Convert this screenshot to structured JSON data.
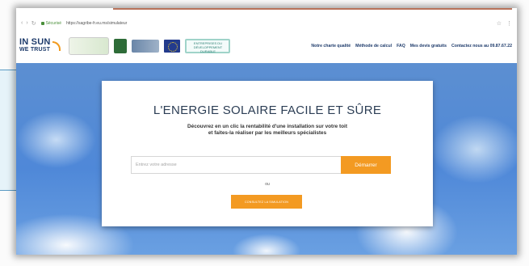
{
  "browser": {
    "secure_label": "Sécurisé",
    "url": "https://sagribe-fr.eu.ms/simulateur",
    "right_icons": [
      "star-icon",
      "menu-icon"
    ]
  },
  "logo": {
    "line1": "IN SUN",
    "line2": "WE TRUST"
  },
  "partners": {
    "p5_text": "ENTREPRISES DU DÉVELOPPEMENT DURABLE"
  },
  "topnav": [
    "Notre charte qualité",
    "Méthode de calcul",
    "FAQ",
    "Mes devis gratuits",
    "Contactez nous au 09.87.67.22"
  ],
  "hero": {
    "title": "L'ENERGIE SOLAIRE FACILE ET SÛRE",
    "lead_line1": "Découvrez en un clic la rentabilité d'une installation sur votre toit",
    "lead_line2": "et faites-la réaliser par les meilleurs spécialistes",
    "address_placeholder": "Entrez votre adresse",
    "start_button": "Démarrer",
    "or_text": "ou",
    "simulate_button": "CONSULTEZ LA SIMULATION"
  },
  "colors": {
    "accent": "#f39a22",
    "brand": "#1e3b6b",
    "sky": "#4f88d8"
  }
}
